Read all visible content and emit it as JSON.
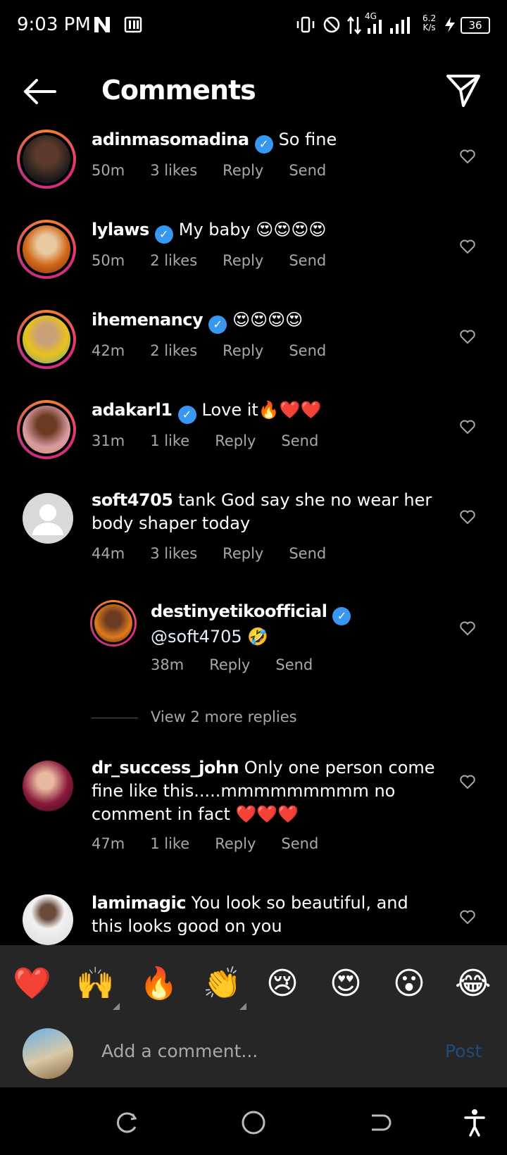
{
  "status_bar": {
    "time": "9:03 PM",
    "network": "4G",
    "speed_value": "6.2",
    "speed_unit": "K/s",
    "battery": "36"
  },
  "header": {
    "title": "Comments"
  },
  "comments": [
    {
      "username": "adinmasomadina",
      "verified": true,
      "text": "So fine",
      "time": "50m",
      "likes": "3 likes",
      "reply": "Reply",
      "send": "Send"
    },
    {
      "username": "lylaws",
      "verified": true,
      "text": "My baby 😍😍😍😍",
      "time": "50m",
      "likes": "2 likes",
      "reply": "Reply",
      "send": "Send"
    },
    {
      "username": "ihemenancy",
      "verified": true,
      "text": "😍😍😍😍",
      "time": "42m",
      "likes": "2 likes",
      "reply": "Reply",
      "send": "Send"
    },
    {
      "username": "adakarl1",
      "verified": true,
      "text": "Love it🔥❤️❤️",
      "time": "31m",
      "likes": "1 like",
      "reply": "Reply",
      "send": "Send"
    },
    {
      "username": "soft4705",
      "verified": false,
      "text": "tank God say she no wear her body shaper today",
      "time": "44m",
      "likes": "3 likes",
      "reply": "Reply",
      "send": "Send"
    },
    {
      "username": "destinyetikoofficial",
      "verified": true,
      "text": "@soft4705 🤣",
      "time": "38m",
      "likes": "",
      "reply": "Reply",
      "send": "Send"
    },
    {
      "username": "dr_success_john",
      "verified": false,
      "text": "Only one person come fine like this.....mmmmmmmmm no comment in fact ❤️❤️❤️",
      "time": "47m",
      "likes": "1 like",
      "reply": "Reply",
      "send": "Send"
    },
    {
      "username": "lamimagic",
      "verified": false,
      "text": "You look so beautiful, and this looks good  on  you",
      "time": "",
      "likes": "",
      "reply": "",
      "send": ""
    }
  ],
  "view_more": "View 2 more replies",
  "emoji_bar": [
    "❤️",
    "🙌",
    "🔥",
    "👏",
    "😢",
    "😍",
    "😮",
    "😂"
  ],
  "input": {
    "placeholder": "Add a comment...",
    "post_label": "Post"
  },
  "colors": {
    "accent": "#3897f0",
    "post_disabled": "#1d4e7a",
    "muted": "#a8a8a8",
    "panel": "#262626"
  }
}
